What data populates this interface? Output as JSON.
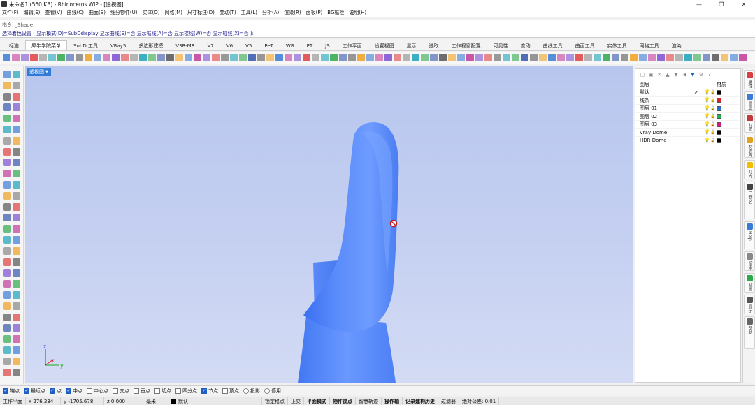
{
  "window": {
    "title": "未命名1 (560 KB) - Rhinoceros WIP - [透视图]",
    "controls": [
      "—",
      "❐",
      "✕"
    ]
  },
  "menu": [
    "文件(F)",
    "编辑(E)",
    "查看(V)",
    "曲线(C)",
    "曲面(S)",
    "细分物件(U)",
    "实体(O)",
    "网格(M)",
    "尺寸标注(D)",
    "变动(T)",
    "工具(L)",
    "分析(A)",
    "渲染(R)",
    "面板(P)",
    "BG框检",
    "说明(H)"
  ],
  "command": {
    "history": "指令: _Shade",
    "prompt": "选择着色设置 ( 显示模式(D)=SubDdisplay 显示曲线(E)=否 显示框线(A)=否 显示楼线(W)=否 显示轴线(X)=否 ):"
  },
  "tabs": [
    "标准",
    "犀牛学院菜单",
    "SubD 工具",
    "VRay5",
    "多边形建模",
    "VSR-MR",
    "V7",
    "V6",
    "V5",
    "PeT",
    "WB",
    "PT",
    "JS",
    "工作平面",
    "设置视图",
    "显示",
    "选取",
    "工作视窗配置",
    "可见性",
    "变动",
    "曲线工具",
    "曲面工具",
    "实体工具",
    "网格工具",
    "渲染"
  ],
  "active_tab_index": 1,
  "viewport": {
    "label": "透视图",
    "axes": {
      "z": "z",
      "x": "x",
      "y": "y"
    }
  },
  "layers": {
    "header_name": "图层",
    "header_material": "材质",
    "rows": [
      {
        "name": "默认",
        "current": true,
        "color": "#000000"
      },
      {
        "name": "线条",
        "current": false,
        "color": "#d8202a"
      },
      {
        "name": "图层 01",
        "current": false,
        "color": "#1f6fd8"
      },
      {
        "name": "图层 02",
        "current": false,
        "color": "#22b14c"
      },
      {
        "name": "图层 03",
        "current": false,
        "color": "#e0157a"
      },
      {
        "name": "Vray Dome",
        "current": false,
        "color": "#000000"
      },
      {
        "name": "HDR Dome",
        "current": false,
        "color": "#000000"
      }
    ]
  },
  "right_tabs": [
    "属性",
    "图层",
    "材质",
    "材质库",
    "灯光",
    "已命名...",
    "Help",
    "渲染",
    "贴图",
    "显示",
    "帮助..."
  ],
  "osnap": [
    {
      "label": "端点",
      "checked": true
    },
    {
      "label": "最近点",
      "checked": true
    },
    {
      "label": "点",
      "checked": true
    },
    {
      "label": "中点",
      "checked": true
    },
    {
      "label": "中心点",
      "checked": false
    },
    {
      "label": "交点",
      "checked": false
    },
    {
      "label": "垂点",
      "checked": false
    },
    {
      "label": "切点",
      "checked": false
    },
    {
      "label": "四分点",
      "checked": false
    },
    {
      "label": "节点",
      "checked": true
    },
    {
      "label": "顶点",
      "checked": false
    },
    {
      "label": "投影",
      "checked": false,
      "radio": true
    },
    {
      "label": "停用",
      "checked": false,
      "radio": true
    }
  ],
  "status": {
    "cplane": "工作平面",
    "x": "x 276.234",
    "y": "y -1705.678",
    "z": "z 0.000",
    "unit": "毫米",
    "layer": "默认",
    "items": [
      "锁定格点",
      "正交",
      "平面模式",
      "物件锁点",
      "智慧轨迹",
      "操作轴",
      "记录建构历史",
      "过滤器"
    ],
    "bold_items": [
      "平面模式",
      "物件锁点",
      "操作轴",
      "记录建构历史"
    ],
    "tolerance": "绝对公差: 0.01"
  }
}
